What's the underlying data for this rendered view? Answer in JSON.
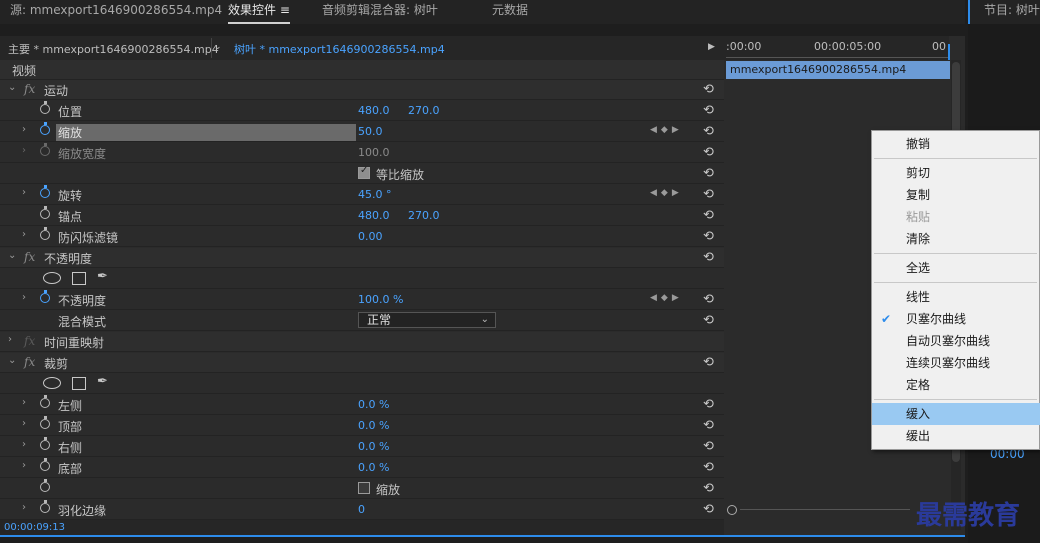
{
  "tabs": {
    "source": "源: mmexport1646900286554.mp4",
    "effect_controls": "效果控件",
    "menu_glyph": "≡",
    "audio_mixer": "音频剪辑混合器: 树叶",
    "metadata": "元数据",
    "program": "节目: 树叶"
  },
  "clipbar": {
    "master": "主要 * mmexport1646900286554.mp4",
    "sequence_clip": "树叶 * mmexport1646900286554.mp4"
  },
  "timeline": {
    "time_start": ":00:00",
    "time_mid": "00:00:05:00",
    "time_end": "00",
    "clip_name": "mmexport1646900286554.mp4"
  },
  "video_header": "视频",
  "motion": {
    "title": "运动",
    "position_label": "位置",
    "position_x": "480.0",
    "position_y": "270.0",
    "scale_label": "缩放",
    "scale_value": "50.0",
    "scale_width_label": "缩放宽度",
    "scale_width_value": "100.0",
    "uniform_scale_label": "等比缩放",
    "rotation_label": "旋转",
    "rotation_value": "45.0 °",
    "anchor_label": "锚点",
    "anchor_x": "480.0",
    "anchor_y": "270.0",
    "flicker_label": "防闪烁滤镜",
    "flicker_value": "0.00"
  },
  "opacity": {
    "title": "不透明度",
    "opacity_label": "不透明度",
    "opacity_value": "100.0 %",
    "blend_label": "混合模式",
    "blend_value": "正常"
  },
  "time_remap": {
    "title": "时间重映射"
  },
  "crop": {
    "title": "裁剪",
    "left_label": "左侧",
    "left_value": "0.0 %",
    "top_label": "顶部",
    "top_value": "0.0 %",
    "right_label": "右侧",
    "right_value": "0.0 %",
    "bottom_label": "底部",
    "bottom_value": "0.0 %",
    "zoom_label": "缩放",
    "feather_label": "羽化边缘",
    "feather_value": "0"
  },
  "status": {
    "time": "00:00:09:13"
  },
  "program_time": "00:00",
  "context_menu": {
    "undo": "撤销",
    "cut": "剪切",
    "copy": "复制",
    "paste": "粘贴",
    "clear": "清除",
    "select_all": "全选",
    "linear": "线性",
    "bezier": "贝塞尔曲线",
    "auto_bezier": "自动贝塞尔曲线",
    "continuous_bezier": "连续贝塞尔曲线",
    "hold": "定格",
    "ease_in": "缓入",
    "ease_out": "缓出"
  },
  "watermark": "最需教育",
  "colors": {
    "accent": "#2d8ceb",
    "value_blue": "#4aa3ff",
    "menu_highlight": "#99c9f2"
  }
}
